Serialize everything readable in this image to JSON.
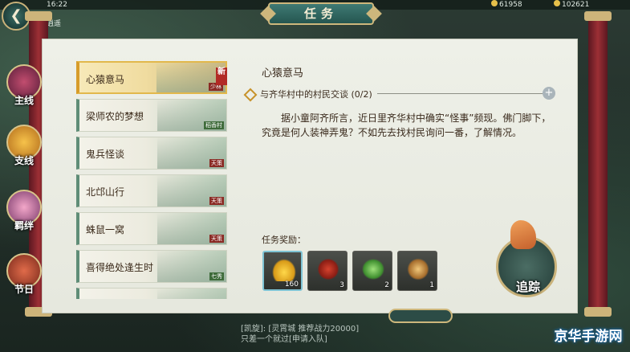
{
  "top": {
    "time": "16:22",
    "channel": "逍遥",
    "currency1": "61958",
    "currency2": "102621"
  },
  "header": {
    "title": "任务"
  },
  "side_nav": [
    {
      "label": "主线"
    },
    {
      "label": "支线",
      "active": true
    },
    {
      "label": "羁绊"
    },
    {
      "label": "节日"
    }
  ],
  "quests": [
    {
      "name": "心猿意马",
      "tag": "少林",
      "new_badge": "新",
      "selected": true
    },
    {
      "name": "梁师农的梦想",
      "tag": "稻香村"
    },
    {
      "name": "鬼兵怪谈",
      "tag": "天策"
    },
    {
      "name": "北邙山行",
      "tag": "天策"
    },
    {
      "name": "蛛鼠一窝",
      "tag": "天策"
    },
    {
      "name": "喜得绝处逢生时",
      "tag": "七秀"
    },
    {
      "name": "",
      "tag": ""
    }
  ],
  "detail": {
    "title": "心猿意马",
    "objective": "与齐华村中的村民交谈",
    "objective_progress": "(0/2)",
    "plus_icon": "+",
    "description": "据小童阿齐所言，近日里齐华村中确实“怪事”频现。佛门脚下，究竟是何人装神弄鬼？不如先去找村民询问一番，了解情况。"
  },
  "rewards": {
    "label": "任务奖励：",
    "items": [
      {
        "icon": "gold-ingot-icon",
        "qty": "160"
      },
      {
        "icon": "red-fruit-icon",
        "qty": "3"
      },
      {
        "icon": "green-vegetable-icon",
        "qty": "2"
      },
      {
        "icon": "monkey-icon",
        "qty": "1"
      }
    ]
  },
  "track_button": {
    "label": "追踪"
  },
  "chat": {
    "line1": "[凯旋]: [灵霄城 推荐战力20000]",
    "line2": "只差一个就过[申请入队]"
  },
  "watermark": "京华手游网"
}
